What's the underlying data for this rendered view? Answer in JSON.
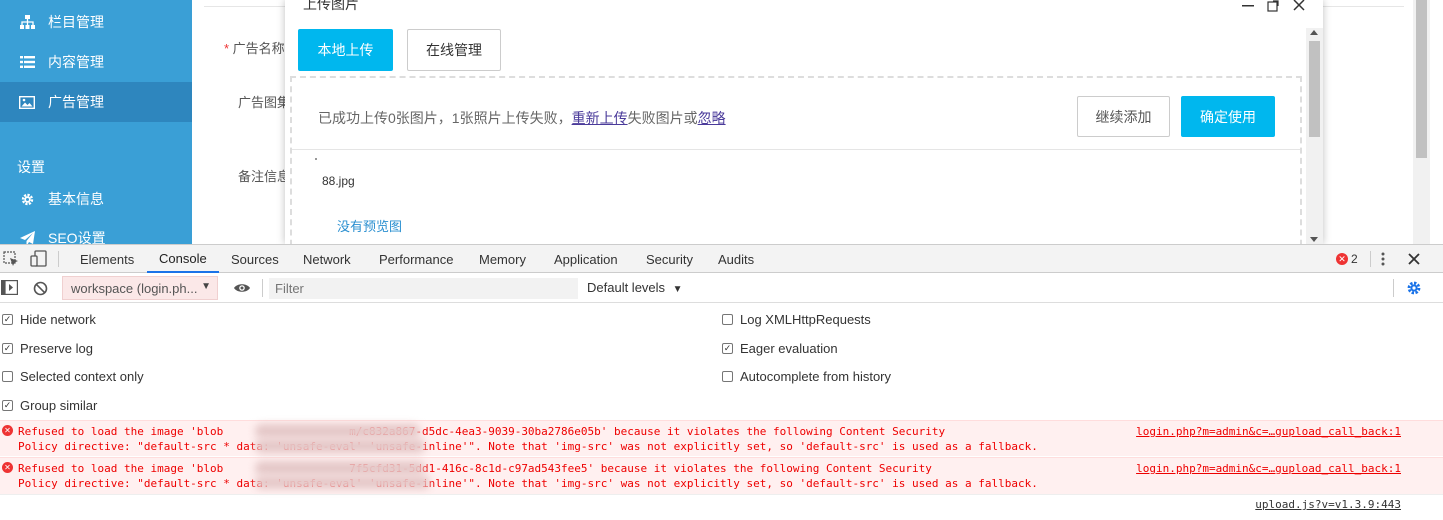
{
  "sidebar": {
    "items": [
      {
        "label": "栏目管理",
        "icon": "sitemap-icon"
      },
      {
        "label": "内容管理",
        "icon": "list-icon"
      },
      {
        "label": "广告管理",
        "icon": "image-icon"
      }
    ],
    "section": "设置",
    "settings_items": [
      {
        "label": "基本信息",
        "icon": "gear-icon"
      },
      {
        "label": "SEO设置",
        "icon": "send-icon"
      }
    ]
  },
  "form": {
    "labels": [
      "广告名称",
      "广告图集",
      "备注信息"
    ]
  },
  "modal": {
    "title": "上传图片",
    "tab_local": "本地上传",
    "tab_online": "在线管理",
    "status_prefix": "已成功上传0张图片，1张照片上传失败，",
    "retry_link": "重新上传",
    "status_middle": "失败图片或",
    "ignore_link": "忽略",
    "continue_button": "继续添加",
    "confirm_button": "确定使用",
    "file_name": "88.jpg",
    "no_preview": "没有预览图"
  },
  "devtools": {
    "tabs": [
      "Elements",
      "Console",
      "Sources",
      "Network",
      "Performance",
      "Memory",
      "Application",
      "Security",
      "Audits"
    ],
    "active_tab": "Console",
    "error_count": "2",
    "context": "workspace (login.ph...",
    "filter_placeholder": "Filter",
    "levels": "Default levels",
    "settings": [
      {
        "label": "Hide network",
        "checked": true
      },
      {
        "label": "Preserve log",
        "checked": true
      },
      {
        "label": "Selected context only",
        "checked": false
      },
      {
        "label": "Group similar",
        "checked": true
      },
      {
        "label": "Log XMLHttpRequests",
        "checked": false
      },
      {
        "label": "Eager evaluation",
        "checked": true
      },
      {
        "label": "Autocomplete from history",
        "checked": false
      }
    ],
    "errors": [
      {
        "line1": "Refused to load the image 'blob                   m/c832a867-d5dc-4ea3-9039-30ba2786e05b' because it violates the following Content Security",
        "line2": "Policy directive: \"default-src * data: 'unsafe-eval' 'unsafe-inline'\". Note that 'img-src' was not explicitly set, so 'default-src' is used as a fallback.",
        "source": "login.php?m=admin&c=…gupload_call_back:1"
      },
      {
        "line1": "Refused to load the image 'blob                   7f5cfd31-5dd1-416c-8c1d-c97ad543fee5' because it violates the following Content Security",
        "line2": "Policy directive: \"default-src * data: 'unsafe-eval' 'unsafe-inline'\". Note that 'img-src' was not explicitly set, so 'default-src' is used as a fallback.",
        "source": "login.php?m=admin&c=…gupload_call_back:1"
      }
    ],
    "footer_source": "upload.js?v=v1.3.9:443"
  },
  "colors": {
    "sidebar_bg": "#3a9fd6",
    "primary_button": "#00b7ee",
    "error_text": "#e00"
  }
}
